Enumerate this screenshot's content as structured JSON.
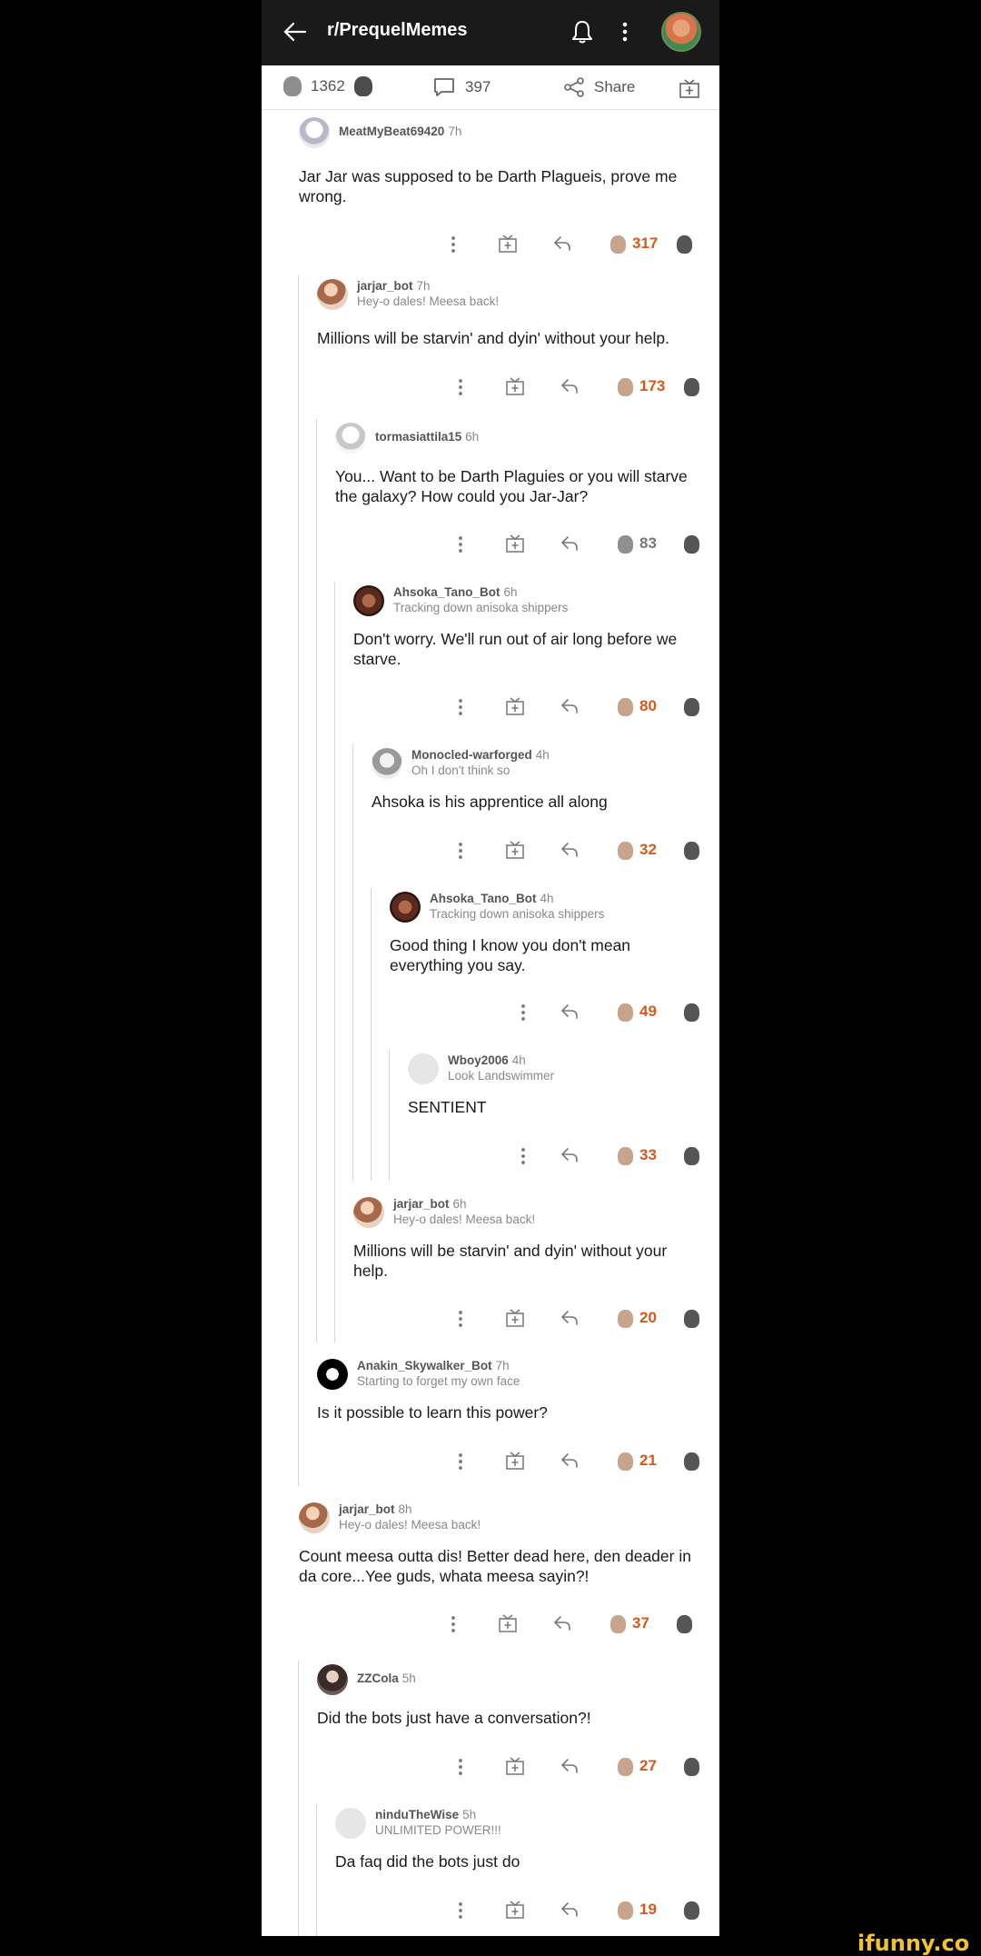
{
  "header": {
    "title": "r/PrequelMemes",
    "icons": [
      "back-arrow-icon",
      "bell-icon",
      "more-vertical-icon",
      "user-avatar"
    ]
  },
  "post_bar": {
    "votes": "1362",
    "comments": "397",
    "share_label": "Share",
    "icons": [
      "upvote-icon",
      "downvote-icon",
      "comment-icon",
      "share-icon",
      "award-icon"
    ]
  },
  "comments": [
    {
      "user": "MeatMyBeat69420",
      "age": "7h",
      "flair": "",
      "body": "Jar Jar was supposed to be Darth Plagueis, prove me wrong.",
      "votes": "317",
      "voted": true,
      "award": true
    },
    {
      "user": "jarjar_bot",
      "age": "7h",
      "flair": "Hey-o dales! Meesa back!",
      "body": "Millions will be starvin' and dyin' without your help.",
      "votes": "173",
      "voted": true,
      "award": true
    },
    {
      "user": "tormasiattila15",
      "age": "6h",
      "flair": "",
      "body": "You... Want to be Darth Plaguies or you will starve the galaxy? How could you Jar-Jar?",
      "votes": "83",
      "voted": false,
      "award": true
    },
    {
      "user": "Ahsoka_Tano_Bot",
      "age": "6h",
      "flair": "Tracking down anisoka shippers",
      "body": "Don't worry. We'll run out of air long before we starve.",
      "votes": "80",
      "voted": true,
      "award": true
    },
    {
      "user": "Monocled-warforged",
      "age": "4h",
      "flair": "Oh I don't think so",
      "body": "Ahsoka is his apprentice all along",
      "votes": "32",
      "voted": true,
      "award": true
    },
    {
      "user": "Ahsoka_Tano_Bot",
      "age": "4h",
      "flair": "Tracking down anisoka shippers",
      "body": "Good thing I know you don't mean everything you say.",
      "votes": "49",
      "voted": true,
      "award": false
    },
    {
      "user": "Wboy2006",
      "age": "4h",
      "flair": "Look Landswimmer",
      "body": "SENTIENT",
      "votes": "33",
      "voted": true,
      "award": false
    },
    {
      "user": "jarjar_bot",
      "age": "6h",
      "flair": "Hey-o dales! Meesa back!",
      "body": "Millions will be starvin' and dyin' without your help.",
      "votes": "20",
      "voted": true,
      "award": true
    },
    {
      "user": "Anakin_Skywalker_Bot",
      "age": "7h",
      "flair": "Starting to forget my own face",
      "body": "Is it possible to learn this power?",
      "votes": "21",
      "voted": true,
      "award": true
    },
    {
      "user": "jarjar_bot",
      "age": "8h",
      "flair": "Hey-o dales! Meesa back!",
      "body": "Count meesa outta dis! Better dead here, den deader in da core...Yee guds, whata meesa sayin?!",
      "votes": "37",
      "voted": true,
      "award": true
    },
    {
      "user": "ZZCola",
      "age": "5h",
      "flair": "",
      "body": "Did the bots just have a conversation?!",
      "votes": "27",
      "voted": true,
      "award": true
    },
    {
      "user": "ninduTheWise",
      "age": "5h",
      "flair": "UNLIMITED POWER!!!",
      "body": "Da faq did the bots just do",
      "votes": "19",
      "voted": true,
      "award": true
    }
  ],
  "colors": {
    "vote_orange": "#d35a1d",
    "header_bg": "#1a1a1b",
    "watermark": "#f2c12e"
  },
  "watermark": "ifunny.co"
}
